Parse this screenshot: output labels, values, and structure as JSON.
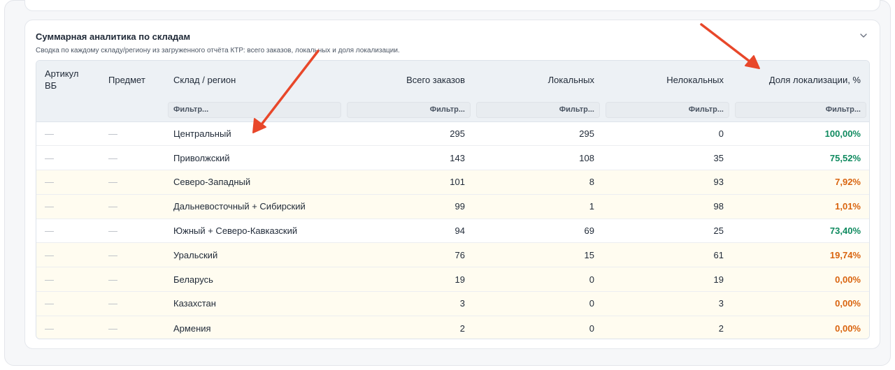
{
  "card": {
    "title": "Суммарная аналитика по складам",
    "subtitle": "Сводка по каждому складу/региону из загруженного отчёта КТР: всего заказов, локальных и доля локализации."
  },
  "table": {
    "headers": [
      "Артикул ВБ",
      "Предмет",
      "Склад / регион",
      "Всего заказов",
      "Локальных",
      "Нелокальных",
      "Доля локализации, %"
    ],
    "filter_placeholder": "Фильтр...",
    "filter_placeholder_short": "Фильтр...",
    "rows": [
      {
        "article": "—",
        "subject": "—",
        "region": "Центральный",
        "total": "295",
        "local": "295",
        "nonlocal": "0",
        "share": "100,00%",
        "level": "good"
      },
      {
        "article": "—",
        "subject": "—",
        "region": "Приволжский",
        "total": "143",
        "local": "108",
        "nonlocal": "35",
        "share": "75,52%",
        "level": "good"
      },
      {
        "article": "—",
        "subject": "—",
        "region": "Северо-Западный",
        "total": "101",
        "local": "8",
        "nonlocal": "93",
        "share": "7,92%",
        "level": "bad"
      },
      {
        "article": "—",
        "subject": "—",
        "region": "Дальневосточный + Сибирский",
        "total": "99",
        "local": "1",
        "nonlocal": "98",
        "share": "1,01%",
        "level": "bad"
      },
      {
        "article": "—",
        "subject": "—",
        "region": "Южный + Северо-Кавказский",
        "total": "94",
        "local": "69",
        "nonlocal": "25",
        "share": "73,40%",
        "level": "good"
      },
      {
        "article": "—",
        "subject": "—",
        "region": "Уральский",
        "total": "76",
        "local": "15",
        "nonlocal": "61",
        "share": "19,74%",
        "level": "bad"
      },
      {
        "article": "—",
        "subject": "—",
        "region": "Беларусь",
        "total": "19",
        "local": "0",
        "nonlocal": "19",
        "share": "0,00%",
        "level": "bad"
      },
      {
        "article": "—",
        "subject": "—",
        "region": "Казахстан",
        "total": "3",
        "local": "0",
        "nonlocal": "3",
        "share": "0,00%",
        "level": "bad"
      },
      {
        "article": "—",
        "subject": "—",
        "region": "Армения",
        "total": "2",
        "local": "0",
        "nonlocal": "2",
        "share": "0,00%",
        "level": "bad"
      }
    ]
  },
  "colors": {
    "good": "#0f8a5f",
    "bad": "#d9640f",
    "arrow": "#e8472a"
  },
  "icons": {
    "collapse": "chevron-down-icon"
  }
}
